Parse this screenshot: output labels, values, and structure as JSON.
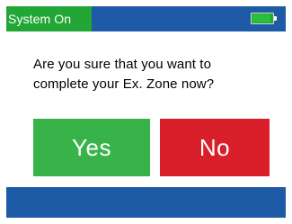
{
  "status": {
    "label": "System On",
    "battery_level": 0.9
  },
  "icons": {
    "battery": "battery-icon"
  },
  "dialog": {
    "line1": "Are you sure that you want to",
    "line2": "complete your Ex. Zone now?"
  },
  "buttons": {
    "yes": "Yes",
    "no": "No"
  },
  "colors": {
    "status_bar": "#1f5aa6",
    "status_badge": "#22a636",
    "yes_button": "#38b34a",
    "no_button": "#d81f2a",
    "bottom_bar": "#1f5aa6"
  }
}
